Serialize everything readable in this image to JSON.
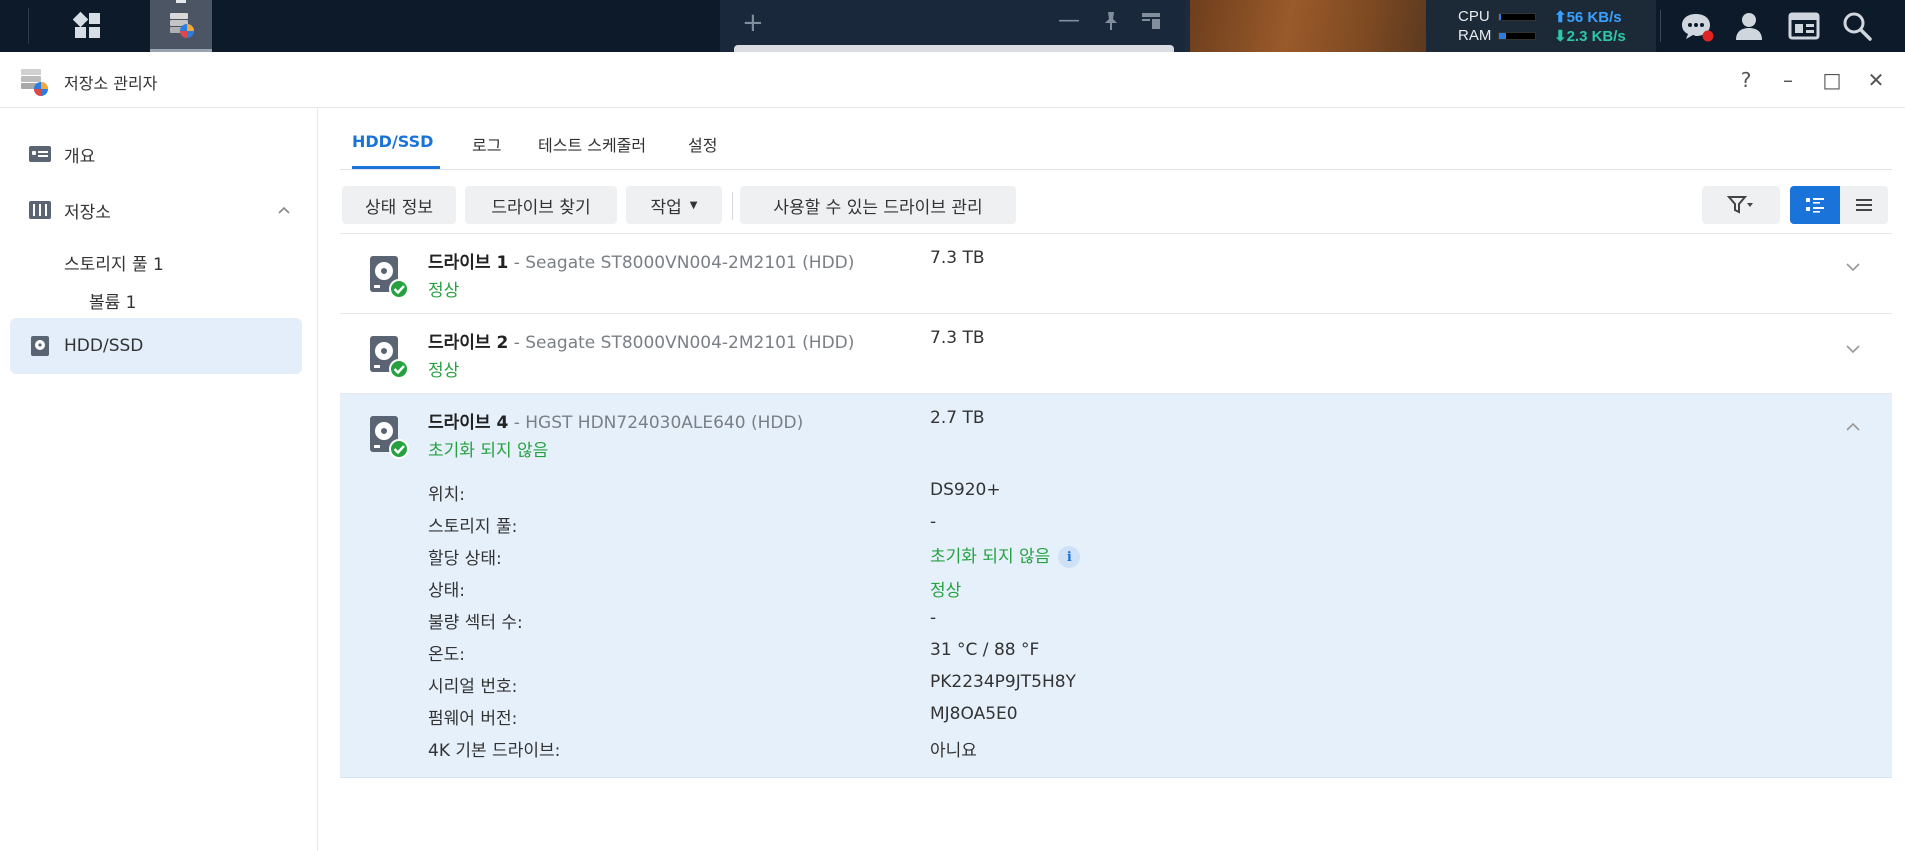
{
  "taskbar": {
    "stats": {
      "cpu_label": "CPU",
      "ram_label": "RAM",
      "cpu_level": 0.05,
      "ram_level": 0.2,
      "upload": "56 KB/s",
      "download": "2.3 KB/s"
    },
    "icons": [
      "main-menu-icon",
      "storage-manager-icon",
      "chat-icon",
      "user-icon",
      "widgets-icon",
      "search-icon"
    ],
    "notification_color": "#e02424"
  },
  "window": {
    "title": "저장소 관리자",
    "controls": [
      "?",
      "–",
      "□",
      "✕"
    ]
  },
  "sidebar": {
    "items": [
      {
        "label": "개요",
        "icon": "overview-icon"
      },
      {
        "label": "저장소",
        "icon": "storage-icon"
      },
      {
        "label": "HDD/SSD",
        "icon": "hdd-icon",
        "active": true
      }
    ],
    "sub_items": [
      {
        "label": "스토리지 풀 1"
      },
      {
        "label": "볼륨 1"
      }
    ]
  },
  "tabs": [
    {
      "label": "HDD/SSD",
      "active": true
    },
    {
      "label": "로그"
    },
    {
      "label": "테스트 스케줄러"
    },
    {
      "label": "설정"
    }
  ],
  "toolbar": {
    "status_info": "상태 정보",
    "find_drive": "드라이브 찾기",
    "action": "작업",
    "manage_available": "사용할 수 있는 드라이브 관리",
    "filter_icon": "filter-icon",
    "list_view_icon": "detail-list-icon",
    "compact_view_icon": "compact-list-icon"
  },
  "drives": [
    {
      "name": "드라이브 1",
      "model": " - Seagate ST8000VN004-2M2101 (HDD)",
      "size": "7.3 TB",
      "status": "정상",
      "expanded": false
    },
    {
      "name": "드라이브 2",
      "model": " - Seagate ST8000VN004-2M2101 (HDD)",
      "size": "7.3 TB",
      "status": "정상",
      "expanded": false
    },
    {
      "name": "드라이브 4",
      "model": " - HGST HDN724030ALE640 (HDD)",
      "size": "2.7 TB",
      "status": "초기화 되지 않음",
      "expanded": true,
      "details": [
        {
          "label": "위치:",
          "value": "DS920+"
        },
        {
          "label": "스토리지 풀:",
          "value": "-"
        },
        {
          "label": "할당 상태:",
          "value": "초기화 되지 않음",
          "green": true,
          "info": true
        },
        {
          "label": "상태:",
          "value": "정상",
          "green": true
        },
        {
          "label": "불량 섹터 수:",
          "value": "-"
        },
        {
          "label": "온도:",
          "value": "31 °C / 88 °F"
        },
        {
          "label": "시리얼 번호:",
          "value": "PK2234P9JT5H8Y"
        },
        {
          "label": "펌웨어 버전:",
          "value": "MJ8OA5E0"
        },
        {
          "label": "4K 기본 드라이브:",
          "value": "아니요"
        }
      ]
    }
  ],
  "colors": {
    "accent": "#1a73d8",
    "status_ok": "#25a240",
    "selected_row": "#e6f0fb",
    "active_nav": "#e4eefb"
  }
}
